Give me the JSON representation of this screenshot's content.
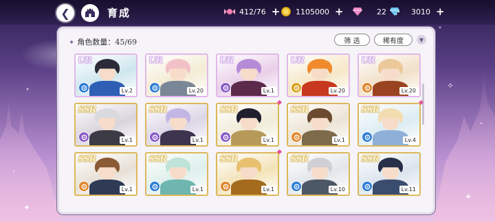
{
  "header": {
    "title": "育成",
    "resources": [
      {
        "name": "candy",
        "icon": "candy-icon",
        "value": "412/76"
      },
      {
        "name": "gold",
        "icon": "gold-coin-icon",
        "value": "1105000"
      },
      {
        "name": "diamond-pink",
        "icon": "pink-diamond-icon",
        "value": "22"
      },
      {
        "name": "diamond-blue",
        "icon": "blue-diamond-icon",
        "value": "3010"
      }
    ],
    "plus": "+"
  },
  "panel": {
    "count_label": "角色数量：45/69",
    "filter_label": "筛 选",
    "rarity_label": "稀有度"
  },
  "cards": [
    {
      "rarity": "UR",
      "level": "Lv.2",
      "attr": "blue",
      "hair": "#2b2b3a",
      "body": "#2f5fb4",
      "bg": "#cfe6ee"
    },
    {
      "rarity": "UR",
      "level": "Lv.20",
      "attr": "blue",
      "hair": "#f2c1c7",
      "body": "#7a8796",
      "bg": "#f3ecd5"
    },
    {
      "rarity": "UR",
      "level": "Lv.1",
      "attr": "purple",
      "hair": "#b58ad6",
      "body": "#5b2a4a",
      "bg": "#e9cfe8"
    },
    {
      "rarity": "UR",
      "level": "Lv.20",
      "attr": "yellow",
      "hair": "#f08a2c",
      "body": "#c8381f",
      "bg": "#f6e7c7"
    },
    {
      "rarity": "UR",
      "level": "Lv.20",
      "attr": "orange",
      "hair": "#ecc99a",
      "body": "#9a4320",
      "bg": "#f1e0c8"
    },
    {
      "rarity": "SSR",
      "level": "Lv.1",
      "attr": "purple",
      "hair": "#d9d9de",
      "body": "#3c3a44",
      "bg": "#d8d4dc"
    },
    {
      "rarity": "SSR",
      "level": "Lv.1",
      "attr": "purple",
      "hair": "#c4b6e4",
      "body": "#3e3450",
      "bg": "#dcd6e6"
    },
    {
      "rarity": "SSR",
      "level": "Lv.1",
      "attr": "purple",
      "hair": "#1f1f2e",
      "body": "#b79a5a",
      "bg": "#f1ecd8"
    },
    {
      "rarity": "SSR",
      "level": "Lv.1",
      "attr": "orange",
      "hair": "#6b4a2e",
      "body": "#7d6a4a",
      "bg": "#ece3d4"
    },
    {
      "rarity": "SSR",
      "level": "Lv.4",
      "attr": "blue",
      "hair": "#f2ddb0",
      "body": "#8fb0d6",
      "bg": "#dcecf3"
    },
    {
      "rarity": "SSR",
      "level": "Lv.1",
      "attr": "orange",
      "hair": "#8a5a35",
      "body": "#2f3a55",
      "bg": "#e7e0d6"
    },
    {
      "rarity": "SSR",
      "level": "Lv.1",
      "attr": "blue",
      "hair": "#bfe3d8",
      "body": "#6fb6b0",
      "bg": "#dff0ec"
    },
    {
      "rarity": "SSR",
      "level": "Lv.1",
      "attr": "orange",
      "hair": "#e8c070",
      "body": "#a46a1d",
      "bg": "#f3e3b8"
    },
    {
      "rarity": "SSR",
      "level": "Lv.10",
      "attr": "blue",
      "hair": "#cfcfd4",
      "body": "#4d5866",
      "bg": "#e3e6ea"
    },
    {
      "rarity": "SSR",
      "level": "Lv.11",
      "attr": "blue",
      "hair": "#273048",
      "body": "#3b4d6e",
      "bg": "#dbe4ee"
    }
  ],
  "colors": {
    "attr_blue": "#2f7fd6",
    "attr_purple": "#8a5cc7",
    "attr_orange": "#e0862c",
    "attr_yellow": "#d9a21c",
    "new_marker": "#e3529a"
  }
}
